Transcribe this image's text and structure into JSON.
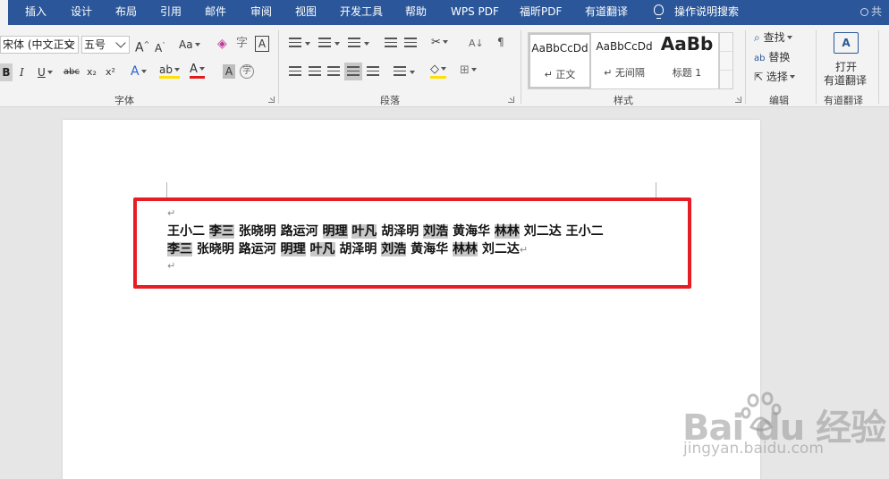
{
  "ribbon_tabs": [
    {
      "label": "插入"
    },
    {
      "label": "设计"
    },
    {
      "label": "布局"
    },
    {
      "label": "引用"
    },
    {
      "label": "邮件"
    },
    {
      "label": "审阅"
    },
    {
      "label": "视图"
    },
    {
      "label": "开发工具"
    },
    {
      "label": "帮助"
    },
    {
      "label": "WPS PDF"
    },
    {
      "label": "福昕PDF"
    },
    {
      "label": "有道翻译"
    }
  ],
  "tell_me": "操作说明搜索",
  "share_label": "共",
  "font_group": {
    "label": "字体",
    "font_name": "宋体 (中文正文",
    "font_size": "五号",
    "grow_label": "A",
    "shrink_label": "A",
    "case_label": "Aa",
    "bold": "B",
    "italic": "I",
    "underline": "U",
    "strike": "abc",
    "subscript": "x₂",
    "superscript": "x²",
    "pinyin_label": "A",
    "highlight_label": "ab",
    "font_color_label": "A",
    "char_shading": "A",
    "enclose_char": "字"
  },
  "paragraph_group": {
    "label": "段落"
  },
  "styles_group": {
    "label": "样式",
    "styles": [
      {
        "preview": "AaBbCcDd",
        "name": "↵ 正文"
      },
      {
        "preview": "AaBbCcDd",
        "name": "↵ 无间隔"
      },
      {
        "preview": "AaBb",
        "name": "标题 1"
      }
    ]
  },
  "editing_group": {
    "label": "编辑",
    "find": "查找",
    "replace": "替换",
    "select": "选择"
  },
  "youdao_group": {
    "label": "有道翻译",
    "open_line1": "打开",
    "open_line2": "有道翻译"
  },
  "document": {
    "line1": [
      {
        "t": "王小二 ",
        "hl": false
      },
      {
        "t": "李三",
        "hl": true
      },
      {
        "t": " 张晓明   路运河   ",
        "hl": false
      },
      {
        "t": "明理",
        "hl": true
      },
      {
        "t": " ",
        "hl": false
      },
      {
        "t": "叶凡",
        "hl": true
      },
      {
        "t": " 胡泽明 ",
        "hl": false
      },
      {
        "t": "刘浩",
        "hl": true
      },
      {
        "t": "   黄海华 ",
        "hl": false
      },
      {
        "t": "林林",
        "hl": true
      },
      {
        "t": "  刘二达 王小二",
        "hl": false
      }
    ],
    "line2": [
      {
        "t": "李三",
        "hl": true
      },
      {
        "t": " 张晓明   路运河   ",
        "hl": false
      },
      {
        "t": "明理",
        "hl": true
      },
      {
        "t": " ",
        "hl": false
      },
      {
        "t": "叶凡",
        "hl": true
      },
      {
        "t": " 胡泽明 ",
        "hl": false
      },
      {
        "t": "刘浩",
        "hl": true
      },
      {
        "t": "   黄海华 ",
        "hl": false
      },
      {
        "t": "林林",
        "hl": true
      },
      {
        "t": "  刘二达",
        "hl": false
      }
    ],
    "paragraph_mark": "↵"
  },
  "watermark": {
    "logo": "Bai  du 经验",
    "url": "jingyan.baidu.com"
  }
}
